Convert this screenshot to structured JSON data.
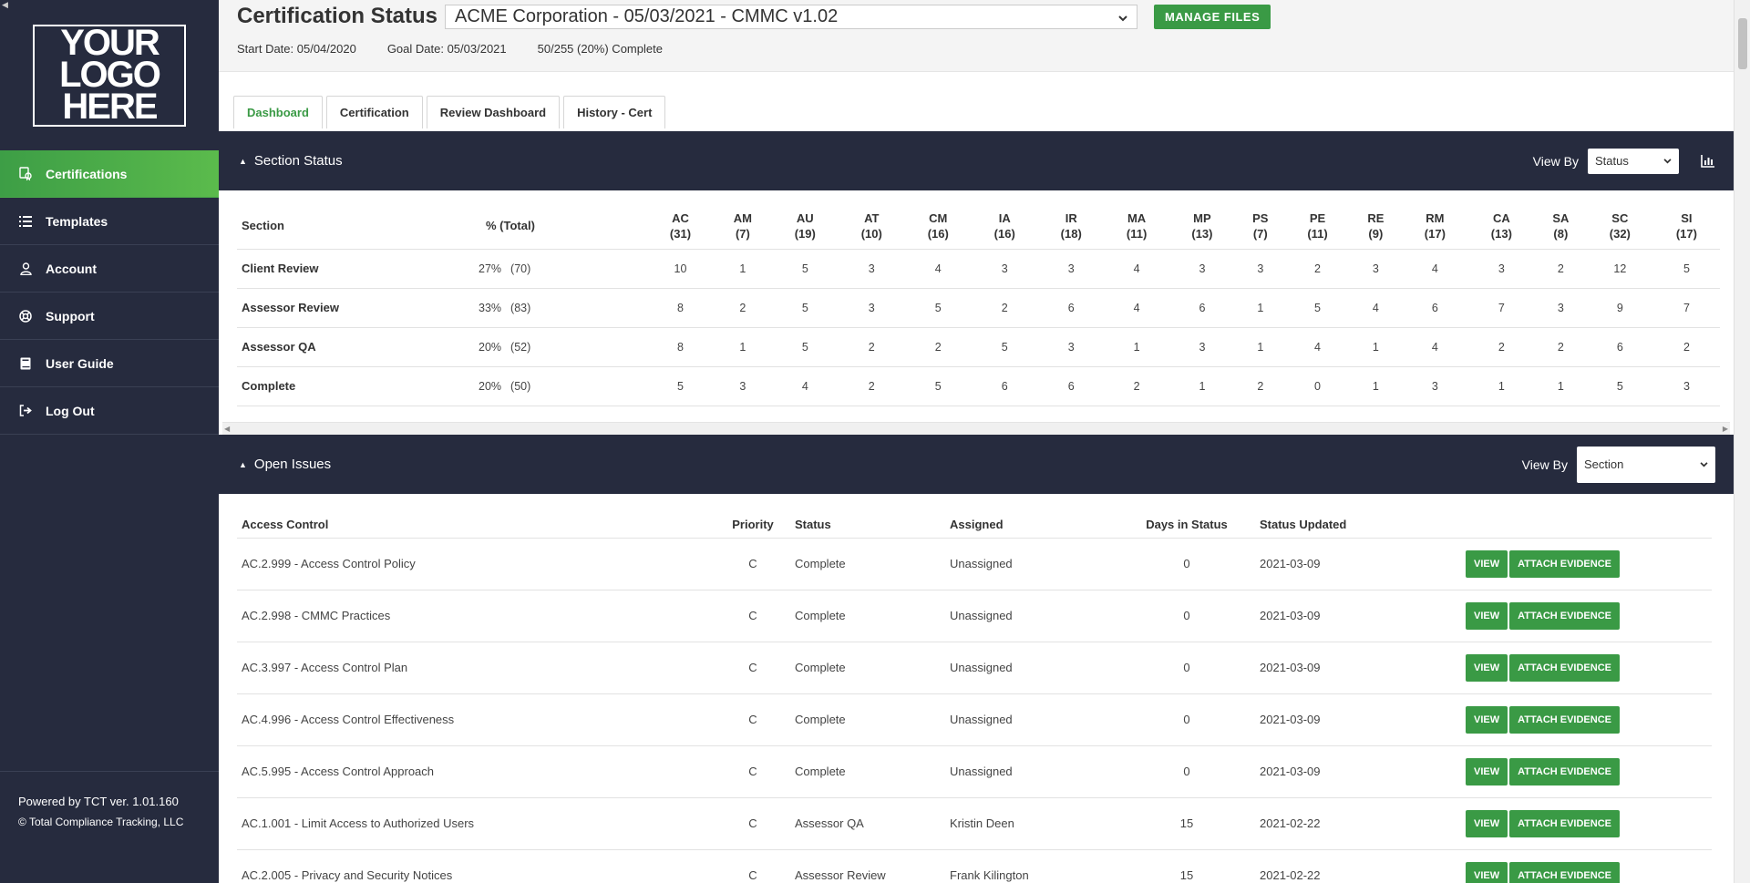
{
  "sidebar": {
    "logo_lines": [
      "YOUR",
      "LOGO",
      "HERE"
    ],
    "items": [
      {
        "label": "Certifications",
        "icon": "certificate-icon",
        "active": true
      },
      {
        "label": "Templates",
        "icon": "list-icon",
        "active": false
      },
      {
        "label": "Account",
        "icon": "user-icon",
        "active": false
      },
      {
        "label": "Support",
        "icon": "lifebuoy-icon",
        "active": false
      },
      {
        "label": "User Guide",
        "icon": "book-icon",
        "active": false
      },
      {
        "label": "Log Out",
        "icon": "logout-icon",
        "active": false
      }
    ],
    "footer": {
      "powered": "Powered by TCT ver. 1.01.160",
      "copyright": "© Total Compliance Tracking, LLC"
    }
  },
  "header": {
    "title": "Certification Status",
    "cert_select": "ACME Corporation - 05/03/2021 - CMMC v1.02",
    "manage_files": "MANAGE FILES",
    "start_date": "Start Date: 05/04/2020",
    "goal_date": "Goal Date: 05/03/2021",
    "progress": "50/255 (20%) Complete"
  },
  "tabs": [
    {
      "label": "Dashboard",
      "active": true
    },
    {
      "label": "Certification",
      "active": false
    },
    {
      "label": "Review Dashboard",
      "active": false
    },
    {
      "label": "History - Cert",
      "active": false
    }
  ],
  "section_status": {
    "title": "Section Status",
    "view_by_label": "View By",
    "view_by_value": "Status",
    "headers": {
      "section": "Section",
      "pct": "% (Total)"
    },
    "columns": [
      {
        "code": "AC",
        "count": "(31)"
      },
      {
        "code": "AM",
        "count": "(7)"
      },
      {
        "code": "AU",
        "count": "(19)"
      },
      {
        "code": "AT",
        "count": "(10)"
      },
      {
        "code": "CM",
        "count": "(16)"
      },
      {
        "code": "IA",
        "count": "(16)"
      },
      {
        "code": "IR",
        "count": "(18)"
      },
      {
        "code": "MA",
        "count": "(11)"
      },
      {
        "code": "MP",
        "count": "(13)"
      },
      {
        "code": "PS",
        "count": "(7)"
      },
      {
        "code": "PE",
        "count": "(11)"
      },
      {
        "code": "RE",
        "count": "(9)"
      },
      {
        "code": "RM",
        "count": "(17)"
      },
      {
        "code": "CA",
        "count": "(13)"
      },
      {
        "code": "SA",
        "count": "(8)"
      },
      {
        "code": "SC",
        "count": "(32)"
      },
      {
        "code": "SI",
        "count": "(17)"
      }
    ],
    "rows": [
      {
        "section": "Client Review",
        "pct": "27%",
        "total": "(70)",
        "values": [
          "10",
          "1",
          "5",
          "3",
          "4",
          "3",
          "3",
          "4",
          "3",
          "3",
          "2",
          "3",
          "4",
          "3",
          "2",
          "12",
          "5"
        ]
      },
      {
        "section": "Assessor Review",
        "pct": "33%",
        "total": "(83)",
        "values": [
          "8",
          "2",
          "5",
          "3",
          "5",
          "2",
          "6",
          "4",
          "6",
          "1",
          "5",
          "4",
          "6",
          "7",
          "3",
          "9",
          "7"
        ]
      },
      {
        "section": "Assessor QA",
        "pct": "20%",
        "total": "(52)",
        "values": [
          "8",
          "1",
          "5",
          "2",
          "2",
          "5",
          "3",
          "1",
          "3",
          "1",
          "4",
          "1",
          "4",
          "2",
          "2",
          "6",
          "2"
        ]
      },
      {
        "section": "Complete",
        "pct": "20%",
        "total": "(50)",
        "values": [
          "5",
          "3",
          "4",
          "2",
          "5",
          "6",
          "6",
          "2",
          "1",
          "2",
          "0",
          "1",
          "3",
          "1",
          "1",
          "5",
          "3"
        ]
      }
    ]
  },
  "open_issues": {
    "title": "Open Issues",
    "view_by_label": "View By",
    "view_by_value": "Section",
    "headers": {
      "control": "Access Control",
      "priority": "Priority",
      "status": "Status",
      "assigned": "Assigned",
      "days": "Days in Status",
      "updated": "Status Updated"
    },
    "view_label": "VIEW",
    "attach_label": "ATTACH EVIDENCE",
    "rows": [
      {
        "control": "AC.2.999 - Access Control Policy",
        "priority": "C",
        "status": "Complete",
        "assigned": "Unassigned",
        "days": "0",
        "updated": "2021-03-09"
      },
      {
        "control": "AC.2.998 - CMMC Practices",
        "priority": "C",
        "status": "Complete",
        "assigned": "Unassigned",
        "days": "0",
        "updated": "2021-03-09"
      },
      {
        "control": "AC.3.997 - Access Control Plan",
        "priority": "C",
        "status": "Complete",
        "assigned": "Unassigned",
        "days": "0",
        "updated": "2021-03-09"
      },
      {
        "control": "AC.4.996 - Access Control Effectiveness",
        "priority": "C",
        "status": "Complete",
        "assigned": "Unassigned",
        "days": "0",
        "updated": "2021-03-09"
      },
      {
        "control": "AC.5.995 - Access Control Approach",
        "priority": "C",
        "status": "Complete",
        "assigned": "Unassigned",
        "days": "0",
        "updated": "2021-03-09"
      },
      {
        "control": "AC.1.001 - Limit Access to Authorized Users",
        "priority": "C",
        "status": "Assessor QA",
        "assigned": "Kristin Deen",
        "days": "15",
        "updated": "2021-02-22"
      },
      {
        "control": "AC.2.005 - Privacy and Security Notices",
        "priority": "C",
        "status": "Assessor Review",
        "assigned": "Frank Kilington",
        "days": "15",
        "updated": "2021-02-22"
      }
    ]
  },
  "colors": {
    "sidebar_bg": "#262b3e",
    "accent_green": "#3a9a45",
    "panel_bar": "#262b3e"
  }
}
